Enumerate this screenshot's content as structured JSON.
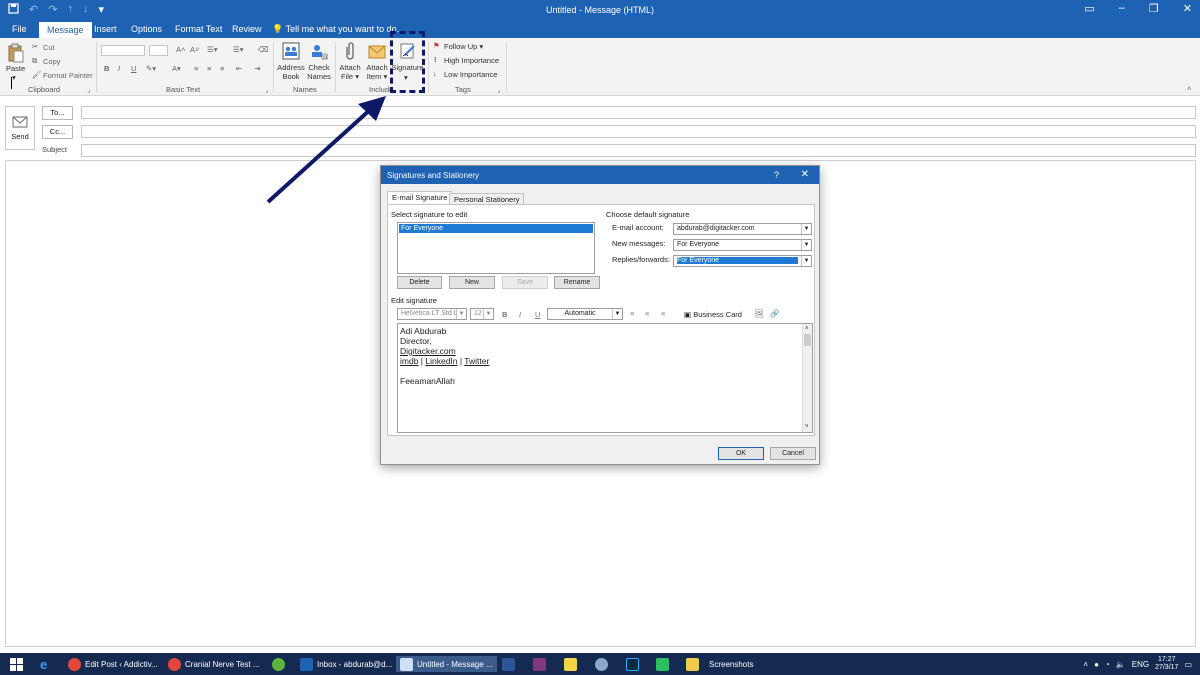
{
  "window": {
    "title": "Untitled - Message (HTML)"
  },
  "tabs": {
    "file": "File",
    "message": "Message",
    "insert": "Insert",
    "options": "Options",
    "format_text": "Format Text",
    "review": "Review",
    "tell_me": "Tell me what you want to do..."
  },
  "ribbon": {
    "clipboard": {
      "paste": "Paste",
      "cut": "Cut",
      "copy": "Copy",
      "format_painter": "Format Painter",
      "label": "Clipboard"
    },
    "basic_text": {
      "label": "Basic Text"
    },
    "names": {
      "address_book_l1": "Address",
      "address_book_l2": "Book",
      "check_names_l1": "Check",
      "check_names_l2": "Names",
      "label": "Names"
    },
    "include": {
      "attach_file_l1": "Attach",
      "attach_file_l2": "File",
      "attach_item_l1": "Attach",
      "attach_item_l2": "Item",
      "signature": "Signature",
      "label": "Include"
    },
    "tags": {
      "follow_up": "Follow Up",
      "high_importance": "High Importance",
      "low_importance": "Low Importance",
      "label": "Tags"
    }
  },
  "compose": {
    "send": "Send",
    "to": "To...",
    "cc": "Cc...",
    "subject": "Subject"
  },
  "dialog": {
    "title": "Signatures and Stationery",
    "help": "?",
    "tabs": {
      "email_signature": "E-mail Signature",
      "personal_stationery": "Personal Stationery"
    },
    "select_label": "Select signature to edit",
    "signatures": [
      "For Everyone"
    ],
    "buttons": {
      "delete": "Delete",
      "new": "New",
      "save": "Save",
      "rename": "Rename",
      "ok": "OK",
      "cancel": "Cancel"
    },
    "defaults": {
      "heading": "Choose default signature",
      "email_account_label": "E-mail account:",
      "email_account_value": "abdurab@digitacker.com",
      "new_messages_label": "New messages:",
      "new_messages_value": "For Everyone",
      "replies_label": "Replies/forwards:",
      "replies_value": "For Everyone"
    },
    "edit": {
      "heading": "Edit signature",
      "font": "Helvetica LT Std Li",
      "size": "12",
      "bold": "B",
      "italic": "I",
      "underline": "U",
      "color": "Automatic",
      "business_card": "Business Card"
    },
    "signature_text": {
      "name": "Adi Abdurab",
      "role": "Director,",
      "site": "Digitacker.com",
      "link_imdb": "imdb",
      "sep1": " | ",
      "link_linkedin": "LinkedIn",
      "sep2": " | ",
      "link_twitter": "Twitter",
      "closing": "FeeamanAllah"
    }
  },
  "taskbar": {
    "items": [
      "Edit Post ‹ Addictiv...",
      "Cranial Nerve Test ...",
      "Inbox - abdurab@d...",
      "Untitled - Message ...",
      "Screenshots"
    ],
    "lang": "ENG",
    "time": "17:27",
    "date": "27/3/17"
  },
  "colors": {
    "accent": "#1e62b3",
    "taskbar": "#142a50",
    "selection": "#1e7bd5",
    "arrow": "#0e1a68"
  }
}
